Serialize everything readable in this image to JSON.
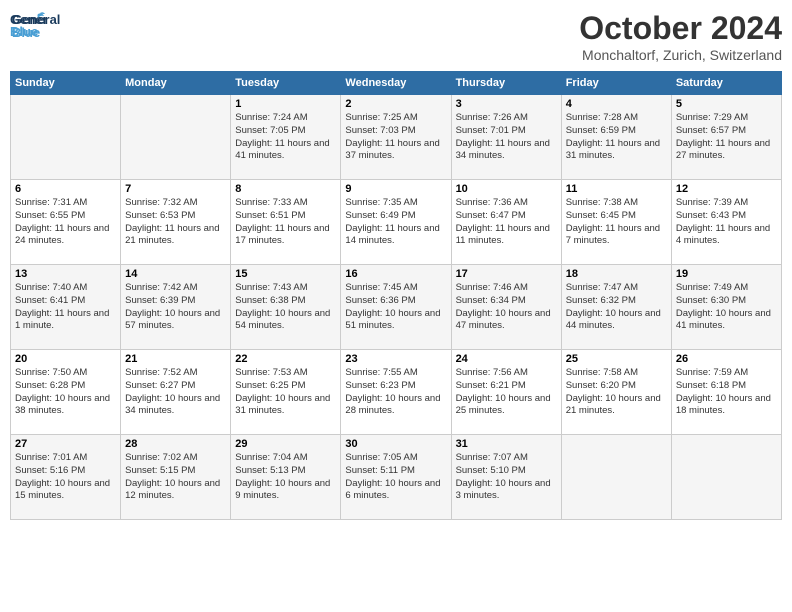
{
  "logo": {
    "line1": "General",
    "line2": "Blue"
  },
  "title": "October 2024",
  "subtitle": "Monchaltorf, Zurich, Switzerland",
  "days_of_week": [
    "Sunday",
    "Monday",
    "Tuesday",
    "Wednesday",
    "Thursday",
    "Friday",
    "Saturday"
  ],
  "weeks": [
    [
      {
        "day": "",
        "info": ""
      },
      {
        "day": "",
        "info": ""
      },
      {
        "day": "1",
        "info": "Sunrise: 7:24 AM\nSunset: 7:05 PM\nDaylight: 11 hours and 41 minutes."
      },
      {
        "day": "2",
        "info": "Sunrise: 7:25 AM\nSunset: 7:03 PM\nDaylight: 11 hours and 37 minutes."
      },
      {
        "day": "3",
        "info": "Sunrise: 7:26 AM\nSunset: 7:01 PM\nDaylight: 11 hours and 34 minutes."
      },
      {
        "day": "4",
        "info": "Sunrise: 7:28 AM\nSunset: 6:59 PM\nDaylight: 11 hours and 31 minutes."
      },
      {
        "day": "5",
        "info": "Sunrise: 7:29 AM\nSunset: 6:57 PM\nDaylight: 11 hours and 27 minutes."
      }
    ],
    [
      {
        "day": "6",
        "info": "Sunrise: 7:31 AM\nSunset: 6:55 PM\nDaylight: 11 hours and 24 minutes."
      },
      {
        "day": "7",
        "info": "Sunrise: 7:32 AM\nSunset: 6:53 PM\nDaylight: 11 hours and 21 minutes."
      },
      {
        "day": "8",
        "info": "Sunrise: 7:33 AM\nSunset: 6:51 PM\nDaylight: 11 hours and 17 minutes."
      },
      {
        "day": "9",
        "info": "Sunrise: 7:35 AM\nSunset: 6:49 PM\nDaylight: 11 hours and 14 minutes."
      },
      {
        "day": "10",
        "info": "Sunrise: 7:36 AM\nSunset: 6:47 PM\nDaylight: 11 hours and 11 minutes."
      },
      {
        "day": "11",
        "info": "Sunrise: 7:38 AM\nSunset: 6:45 PM\nDaylight: 11 hours and 7 minutes."
      },
      {
        "day": "12",
        "info": "Sunrise: 7:39 AM\nSunset: 6:43 PM\nDaylight: 11 hours and 4 minutes."
      }
    ],
    [
      {
        "day": "13",
        "info": "Sunrise: 7:40 AM\nSunset: 6:41 PM\nDaylight: 11 hours and 1 minute."
      },
      {
        "day": "14",
        "info": "Sunrise: 7:42 AM\nSunset: 6:39 PM\nDaylight: 10 hours and 57 minutes."
      },
      {
        "day": "15",
        "info": "Sunrise: 7:43 AM\nSunset: 6:38 PM\nDaylight: 10 hours and 54 minutes."
      },
      {
        "day": "16",
        "info": "Sunrise: 7:45 AM\nSunset: 6:36 PM\nDaylight: 10 hours and 51 minutes."
      },
      {
        "day": "17",
        "info": "Sunrise: 7:46 AM\nSunset: 6:34 PM\nDaylight: 10 hours and 47 minutes."
      },
      {
        "day": "18",
        "info": "Sunrise: 7:47 AM\nSunset: 6:32 PM\nDaylight: 10 hours and 44 minutes."
      },
      {
        "day": "19",
        "info": "Sunrise: 7:49 AM\nSunset: 6:30 PM\nDaylight: 10 hours and 41 minutes."
      }
    ],
    [
      {
        "day": "20",
        "info": "Sunrise: 7:50 AM\nSunset: 6:28 PM\nDaylight: 10 hours and 38 minutes."
      },
      {
        "day": "21",
        "info": "Sunrise: 7:52 AM\nSunset: 6:27 PM\nDaylight: 10 hours and 34 minutes."
      },
      {
        "day": "22",
        "info": "Sunrise: 7:53 AM\nSunset: 6:25 PM\nDaylight: 10 hours and 31 minutes."
      },
      {
        "day": "23",
        "info": "Sunrise: 7:55 AM\nSunset: 6:23 PM\nDaylight: 10 hours and 28 minutes."
      },
      {
        "day": "24",
        "info": "Sunrise: 7:56 AM\nSunset: 6:21 PM\nDaylight: 10 hours and 25 minutes."
      },
      {
        "day": "25",
        "info": "Sunrise: 7:58 AM\nSunset: 6:20 PM\nDaylight: 10 hours and 21 minutes."
      },
      {
        "day": "26",
        "info": "Sunrise: 7:59 AM\nSunset: 6:18 PM\nDaylight: 10 hours and 18 minutes."
      }
    ],
    [
      {
        "day": "27",
        "info": "Sunrise: 7:01 AM\nSunset: 5:16 PM\nDaylight: 10 hours and 15 minutes."
      },
      {
        "day": "28",
        "info": "Sunrise: 7:02 AM\nSunset: 5:15 PM\nDaylight: 10 hours and 12 minutes."
      },
      {
        "day": "29",
        "info": "Sunrise: 7:04 AM\nSunset: 5:13 PM\nDaylight: 10 hours and 9 minutes."
      },
      {
        "day": "30",
        "info": "Sunrise: 7:05 AM\nSunset: 5:11 PM\nDaylight: 10 hours and 6 minutes."
      },
      {
        "day": "31",
        "info": "Sunrise: 7:07 AM\nSunset: 5:10 PM\nDaylight: 10 hours and 3 minutes."
      },
      {
        "day": "",
        "info": ""
      },
      {
        "day": "",
        "info": ""
      }
    ]
  ]
}
